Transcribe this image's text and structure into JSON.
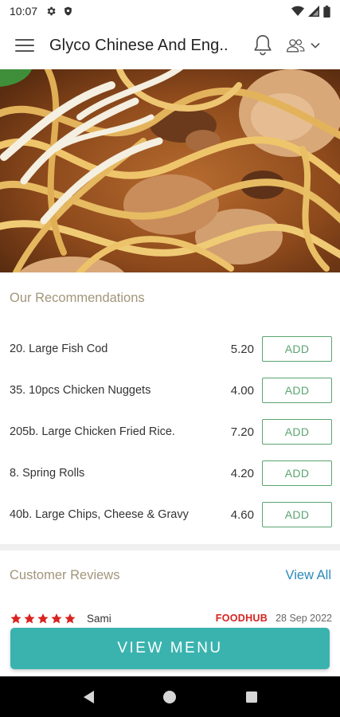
{
  "status_bar": {
    "time": "10:07",
    "left_icons": [
      "gear-icon",
      "shield-icon"
    ],
    "right_icons": [
      "wifi-icon",
      "signal-icon",
      "battery-icon"
    ]
  },
  "app_bar": {
    "title": "Glyco Chinese And Eng..",
    "icons": [
      "menu-icon",
      "bell-icon",
      "user-group-icon",
      "chevron-down-icon"
    ]
  },
  "hero": {
    "icon": "food-photo-noodles"
  },
  "recommendations": {
    "title": "Our Recommendations",
    "add_label": "ADD",
    "items": [
      {
        "name": "20. Large Fish Cod",
        "price": "5.20"
      },
      {
        "name": "35. 10pcs Chicken Nuggets",
        "price": "4.00"
      },
      {
        "name": "205b. Large Chicken Fried Rice.",
        "price": "7.20"
      },
      {
        "name": "8. Spring Rolls",
        "price": "4.20"
      },
      {
        "name": "40b. Large Chips, Cheese & Gravy",
        "price": "4.60"
      }
    ]
  },
  "reviews": {
    "title": "Customer Reviews",
    "view_all": "View All",
    "items": [
      {
        "rating": 5,
        "reviewer": "Sami",
        "source": "FOODHUB",
        "date": "28 Sep 2022"
      }
    ]
  },
  "view_menu": {
    "label": "VIEW MENU"
  },
  "colors": {
    "accent_teal": "#3ab3af",
    "add_green": "#5aa471",
    "section_title": "#a2957a",
    "link_blue": "#2b89b8",
    "star_red": "#d8231f",
    "brand_red": "#d8231f"
  },
  "nav_bar": {
    "icons": [
      "back-icon",
      "home-icon",
      "recents-icon"
    ]
  }
}
